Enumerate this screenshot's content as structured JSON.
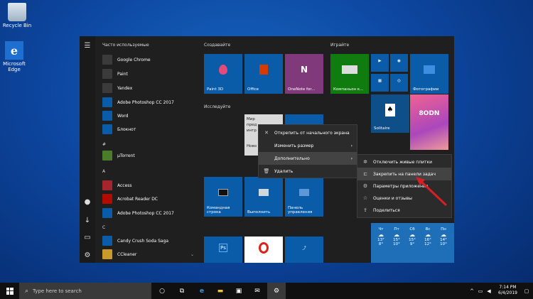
{
  "desktop": {
    "icons": [
      {
        "label": "Recycle Bin"
      },
      {
        "label": "Microsoft Edge"
      }
    ]
  },
  "start_menu": {
    "sections": {
      "frequent": "Часто используемые",
      "hash": "#",
      "a": "A",
      "c": "C"
    },
    "frequent_apps": [
      "Google Chrome",
      "Paint",
      "Yandex",
      "Adobe Photoshop CC 2017",
      "Word",
      "Блокнот"
    ],
    "hash_apps": [
      "µTorrent"
    ],
    "a_apps": [
      "Access",
      "Acrobat Reader DC",
      "Adobe Photoshop CC 2017"
    ],
    "c_apps": [
      "Candy Crush Soda Saga",
      "CCleaner"
    ],
    "groups": {
      "create": "Создавайте",
      "explore": "Исследуйте",
      "play": "Играйте"
    },
    "tiles": {
      "paint3d": "Paint 3D",
      "office": "Office",
      "onenote": "OneNote for...",
      "companion": "Компаньон к...",
      "photos": "Фотографии",
      "solitaire": "Solitaire",
      "candy": "8ODN",
      "cmd": "Командная строка",
      "run": "Выполнить",
      "control": "Панель управления",
      "explore_partial": [
        "Мир",
        "пред",
        "интр",
        "Ново"
      ]
    },
    "weather_days": [
      {
        "day": "Чт",
        "hi": "13°",
        "lo": "8°"
      },
      {
        "day": "Пт",
        "hi": "15°",
        "lo": "10°"
      },
      {
        "day": "Сб",
        "hi": "15°",
        "lo": "9°"
      },
      {
        "day": "Вс",
        "hi": "16°",
        "lo": "12°"
      },
      {
        "day": "Пн",
        "hi": "14°",
        "lo": "10°"
      }
    ]
  },
  "context_menu": {
    "items": [
      "Открепить от начального экрана",
      "Изменить размер",
      "Дополнительно",
      "Удалить"
    ]
  },
  "submenu": {
    "items": [
      "Отключить живые плитки",
      "Закрепить на панели задач",
      "Параметры приложения",
      "Оценки и отзывы",
      "Поделиться"
    ]
  },
  "taskbar": {
    "search_placeholder": "Type here to search",
    "time": "7:14 PM",
    "date": "6/4/2019"
  },
  "colors": {
    "accent": "#0b5ca8",
    "arrow": "#d81f26"
  }
}
